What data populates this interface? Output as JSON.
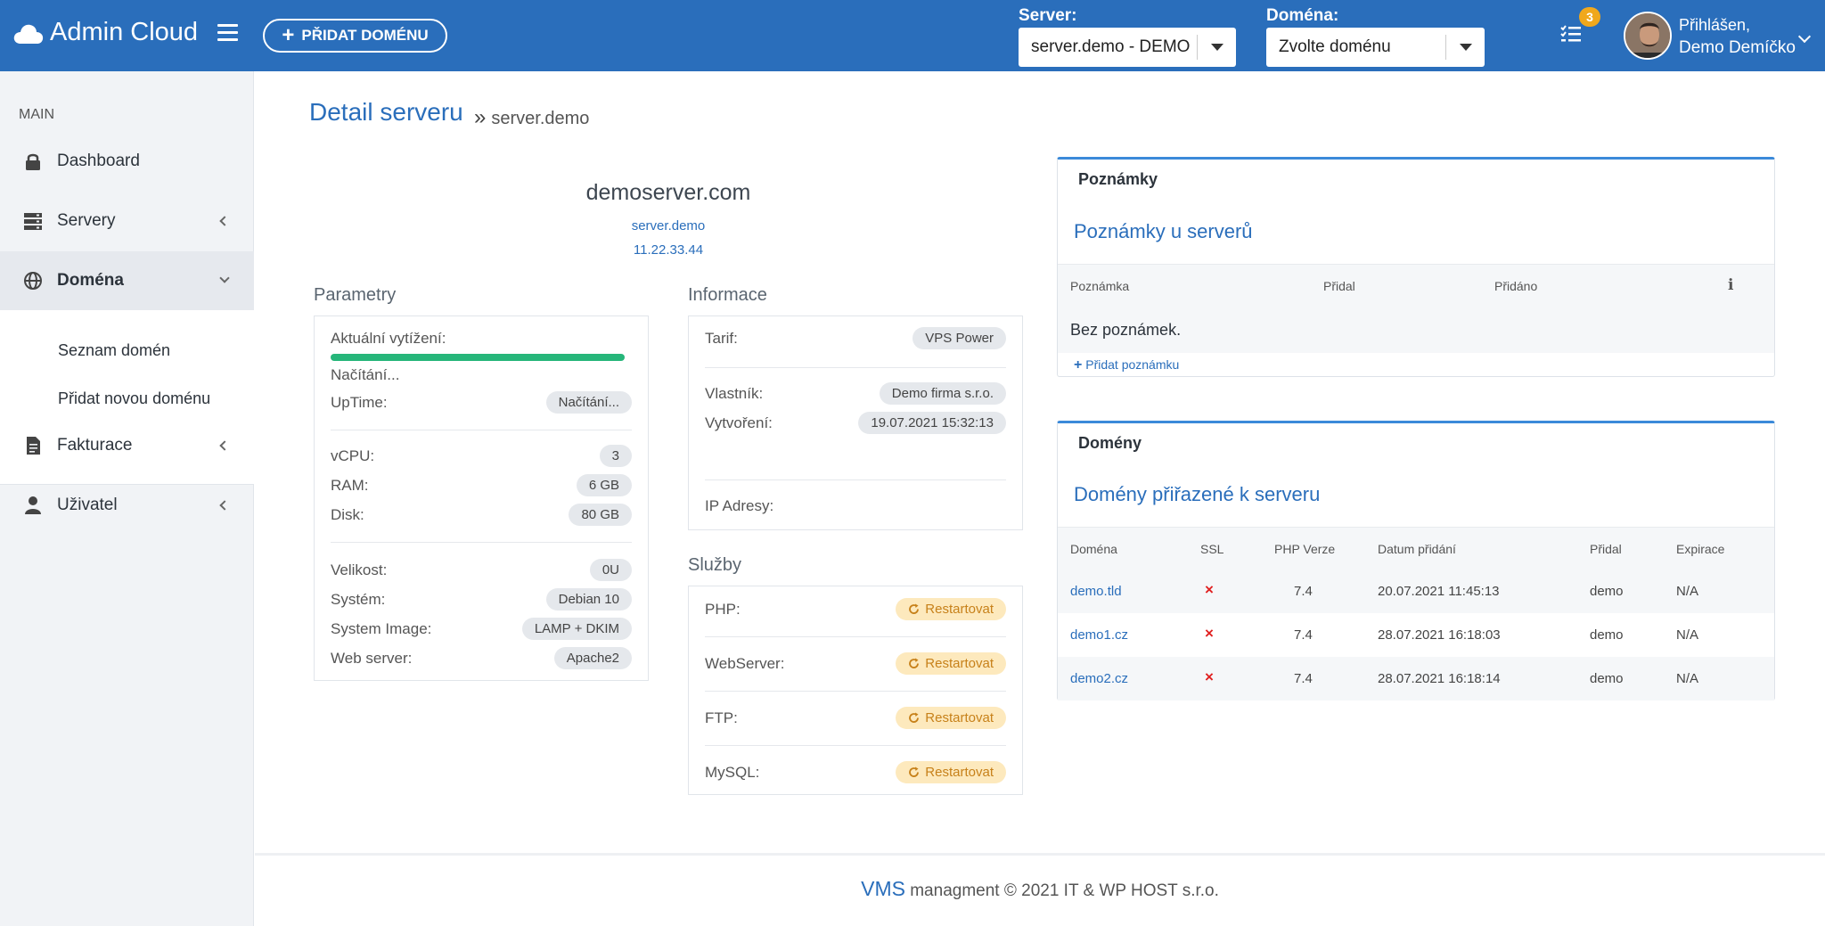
{
  "header": {
    "brand": "Admin Cloud",
    "add_domain_label": "PŘIDAT DOMÉNU",
    "server_label": "Server:",
    "server_value": "server.demo - DEMO",
    "domain_label": "Doména:",
    "domain_value": "Zvolte doménu",
    "tasks_badge": "3",
    "user_greeting": "Přihlášen,",
    "user_name": "Demo Demíčko",
    "brand_color": "#2a6ebb"
  },
  "sidebar": {
    "section": "MAIN",
    "items": [
      {
        "label": "Dashboard",
        "icon": "lock-icon"
      },
      {
        "label": "Servery",
        "icon": "server-icon"
      },
      {
        "label": "Doména",
        "icon": "globe-icon"
      },
      {
        "label": "Fakturace",
        "icon": "invoice-icon"
      },
      {
        "label": "Uživatel",
        "icon": "user-icon"
      }
    ],
    "submenu": [
      "Seznam domén",
      "Přidat novou doménu"
    ]
  },
  "page": {
    "title": "Detail serveru",
    "breadcrumb_sep": "»",
    "subtitle": "server.demo"
  },
  "server": {
    "hostname": "demoserver.com",
    "name": "server.demo",
    "ip": "11.22.33.44"
  },
  "params": {
    "title": "Parametry",
    "load_label": "Aktuální vytížení:",
    "load_fraction": 1.0,
    "loading_text": "Načítání...",
    "uptime_label": "UpTime:",
    "uptime_value": "Načítání...",
    "vcpu_label": "vCPU:",
    "vcpu_value": "3",
    "ram_label": "RAM:",
    "ram_value": "6 GB",
    "disk_label": "Disk:",
    "disk_value": "80 GB",
    "size_label": "Velikost:",
    "size_value": "0U",
    "system_label": "Systém:",
    "system_value": "Debian 10",
    "image_label": "System Image:",
    "image_value": "LAMP + DKIM",
    "web_label": "Web server:",
    "web_value": "Apache2"
  },
  "info": {
    "title": "Informace",
    "tarif_label": "Tarif:",
    "tarif_value": "VPS Power",
    "owner_label": "Vlastník:",
    "owner_value": "Demo firma s.r.o.",
    "created_label": "Vytvoření:",
    "created_value": "19.07.2021 15:32:13",
    "ip_label": "IP Adresy:"
  },
  "services": {
    "title": "Služby",
    "restart_label": "Restartovat",
    "items": [
      "PHP:",
      "WebServer:",
      "FTP:",
      "MySQL:"
    ]
  },
  "notes": {
    "head": "Poznámky",
    "title": "Poznámky u serverů",
    "columns": [
      "Poznámka",
      "Přidal",
      "Přidáno"
    ],
    "info_glyph": "ℹ",
    "empty": "Bez poznámek.",
    "add_label": "Přidat poznámku"
  },
  "domains": {
    "head": "Domény",
    "title": "Domény přiřazené k serveru",
    "columns": [
      "Doména",
      "SSL",
      "PHP Verze",
      "Datum přidání",
      "Přidal",
      "Expirace"
    ],
    "rows": [
      {
        "domain": "demo.tld",
        "ssl": "×",
        "php": "7.4",
        "date": "20.07.2021 11:45:13",
        "by": "demo",
        "exp": "N/A"
      },
      {
        "domain": "demo1.cz",
        "ssl": "×",
        "php": "7.4",
        "date": "28.07.2021 16:18:03",
        "by": "demo",
        "exp": "N/A"
      },
      {
        "domain": "demo2.cz",
        "ssl": "×",
        "php": "7.4",
        "date": "28.07.2021 16:18:14",
        "by": "demo",
        "exp": "N/A"
      }
    ]
  },
  "footer": {
    "vms": "VMS",
    "text": "managment © 2021 IT & WP HOST s.r.o."
  }
}
